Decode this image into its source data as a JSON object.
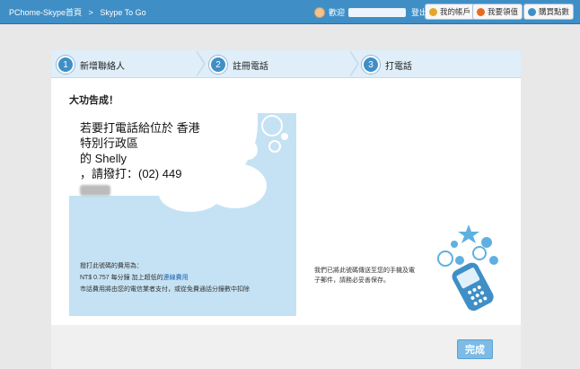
{
  "topbar": {
    "crumb_home": "PChome-Skype首頁",
    "crumb_sep": ">",
    "crumb_current": "Skype To Go",
    "welcome": "歡迎",
    "logout": "登出",
    "my_account": "我的帳戶",
    "support": "我要領值",
    "buy": "購買點數"
  },
  "steps": [
    {
      "num": "1",
      "label": "新增聯絡人"
    },
    {
      "num": "2",
      "label": "註冊電話"
    },
    {
      "num": "3",
      "label": "打電話"
    }
  ],
  "content": {
    "done_title": "大功告成！",
    "line1": "若要打電話給位於 香港",
    "line2": "特別行政區",
    "line3": "的 Shelly",
    "line4": "，請撥打：(02) 449",
    "fee_label": "撥打此號碼的費用為：",
    "fee_rate": "NT$ 0.757 每分鐘 加上超低的",
    "fee_link": "連線費用",
    "fee_note": "市話費用將由您的電信業者支付，或從免費通話分鐘數中扣除",
    "sent_note": "我們已將此號碼傳送至您的手機及電子郵件，請務必妥善保存。"
  },
  "footer": {
    "done_button": "完成"
  },
  "colors": {
    "accent": "#3f8fc6",
    "box": "#c5e2f4",
    "button": "#7cbbe6"
  }
}
